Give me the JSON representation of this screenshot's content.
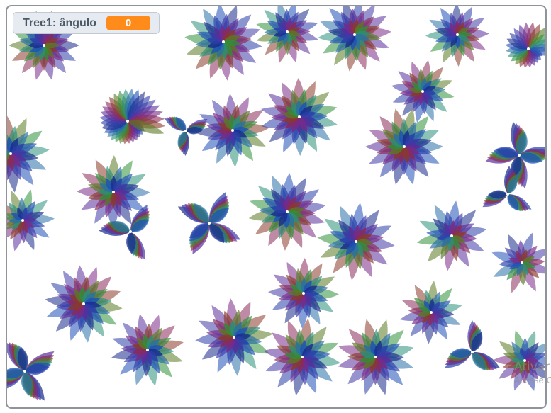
{
  "monitor": {
    "label": "Tree1: ângulo",
    "value": "0"
  },
  "watermark": {
    "line1": "Ativar o Windows",
    "line2": "Acesse Configurações"
  },
  "colors": {
    "monitor_value_bg": "#ff8c1a",
    "stage_border": "#8f949b",
    "monitor_bg": "#e6ebf2"
  }
}
